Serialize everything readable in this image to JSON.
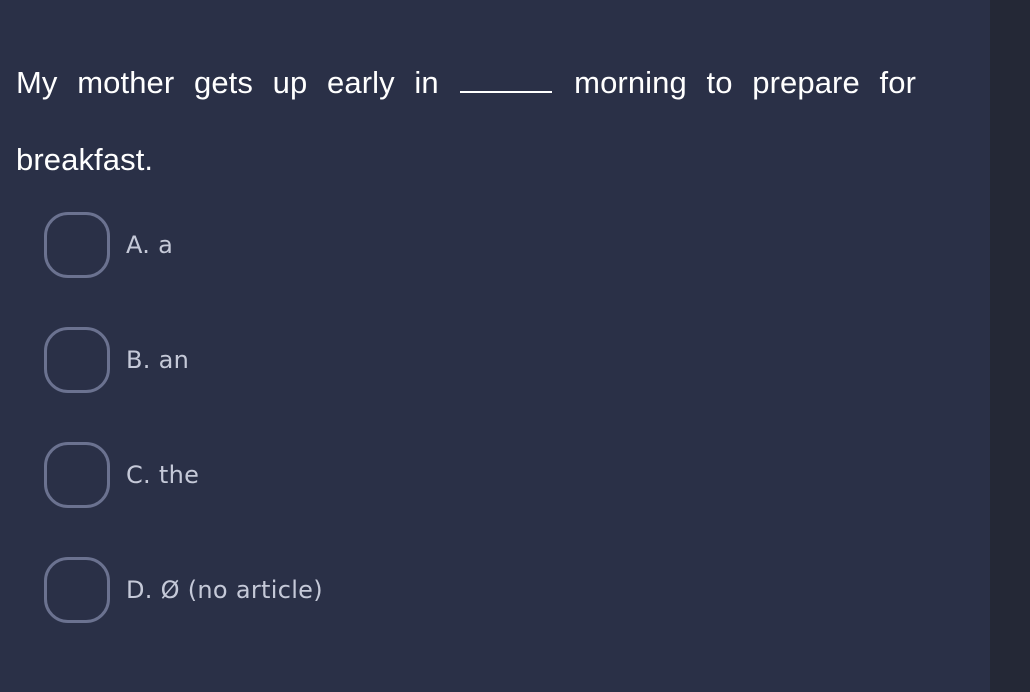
{
  "theme": {
    "panel_background": "#2a3047",
    "gutter_background": "#242836",
    "question_color": "#ffffff",
    "option_color": "#c5c9d8",
    "radio_border_color": "#6b7290"
  },
  "question": {
    "text_before_blank": "My mother gets up early in ",
    "blank": "_____",
    "text_after_blank": " morning to prepare for breakfast.",
    "full_text": "My mother gets up early in _____ morning to prepare for breakfast."
  },
  "options": [
    {
      "id": "A",
      "marker": "A.",
      "text": "a",
      "label": "A. a",
      "selected": false
    },
    {
      "id": "B",
      "marker": "B.",
      "text": "an",
      "label": "B. an",
      "selected": false
    },
    {
      "id": "C",
      "marker": "C.",
      "text": "the",
      "label": "C. the",
      "selected": false
    },
    {
      "id": "D",
      "marker": "D.",
      "text": "Ø (no article)",
      "label": "D. Ø (no article)",
      "selected": false
    }
  ]
}
